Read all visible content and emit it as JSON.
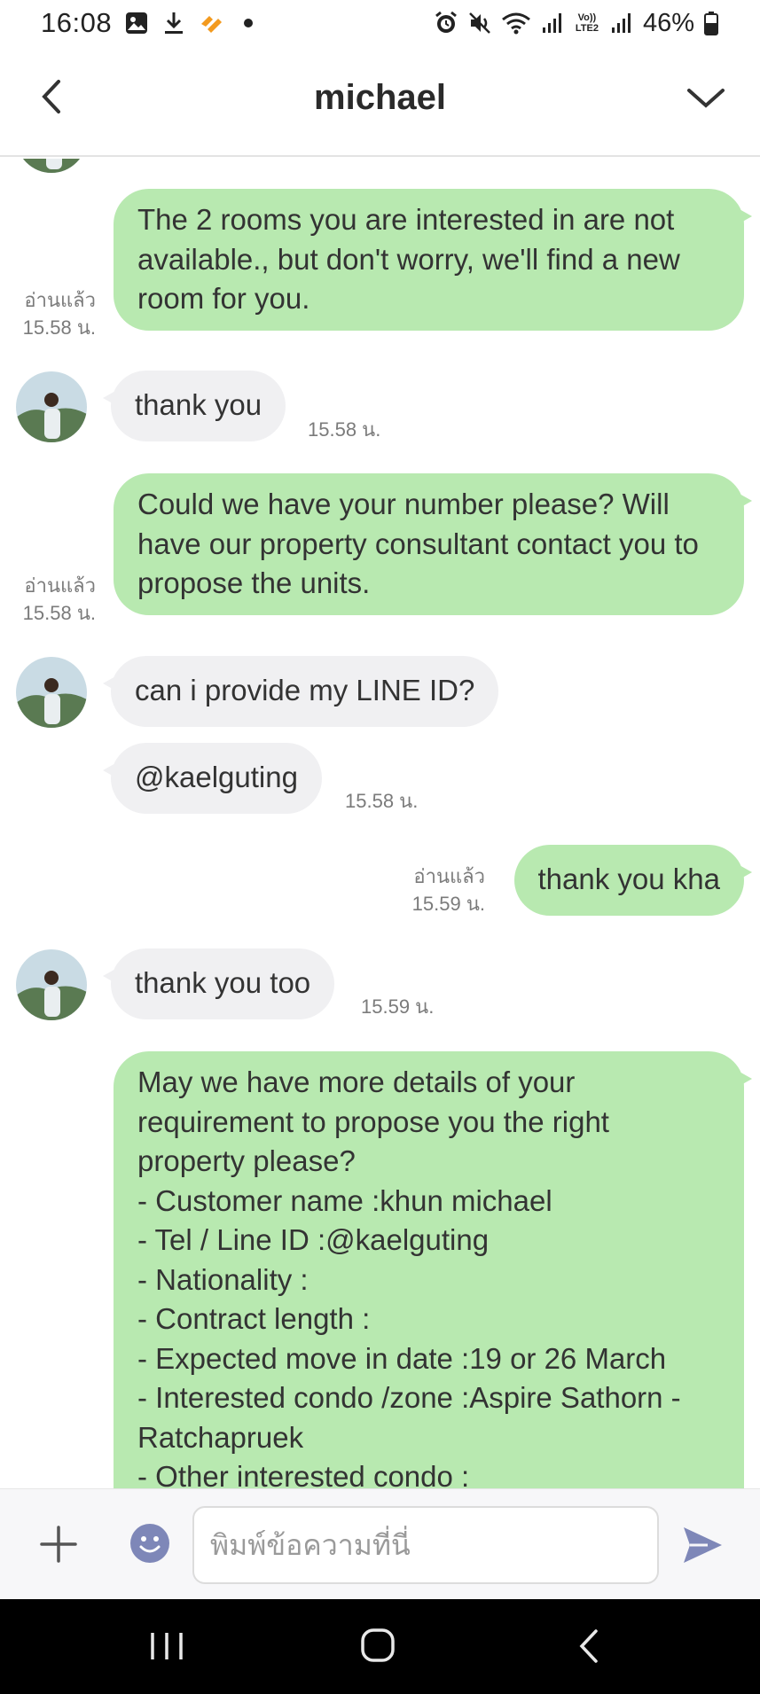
{
  "status_bar": {
    "time": "16:08",
    "battery_percent": "46%",
    "icons_left": [
      "image-icon",
      "download-icon",
      "app-notification-icon",
      "dot-icon"
    ],
    "icons_right": [
      "alarm-icon",
      "mute-icon",
      "wifi-icon",
      "signal-icon",
      "volte-icon",
      "signal-icon",
      "battery-icon"
    ],
    "volte_label": "Vo)) LTE2"
  },
  "header": {
    "title": "michael"
  },
  "messages": [
    {
      "dir": "out",
      "text": "The 2 rooms you are interested in are not available., but don't worry, we'll find a new room for you.",
      "read": "อ่านแล้ว",
      "time": "15.58 น."
    },
    {
      "dir": "in",
      "text": "thank you",
      "time": "15.58 น."
    },
    {
      "dir": "out",
      "text": "Could we have your number please? Will have our property consultant contact you to propose the units.",
      "read": "อ่านแล้ว",
      "time": "15.58 น."
    },
    {
      "dir": "in",
      "text": "can i provide my LINE ID?"
    },
    {
      "dir": "in",
      "text": "@kaelguting",
      "time": "15.58 น."
    },
    {
      "dir": "out",
      "text": "thank you kha",
      "read": "อ่านแล้ว",
      "time": "15.59 น."
    },
    {
      "dir": "in",
      "text": "thank you too",
      "time": "15.59 น."
    },
    {
      "dir": "out",
      "lines": [
        "May we have more details of your",
        "requirement to propose you the right",
        "property please?",
        "- Customer name :khun michael",
        "- Tel / Line ID :@kaelguting",
        "- Nationality :",
        "- Contract length :",
        "- Expected move in date :19 or 26 March",
        "- Interested condo /zone :Aspire Sathorn -",
        "Ratchapruek",
        "- Other interested condo :"
      ]
    }
  ],
  "input": {
    "placeholder": "พิมพ์ข้อความที่นี่",
    "value": ""
  },
  "colors": {
    "outgoing_bubble": "#b8e9b0",
    "incoming_bubble": "#f0f0f2",
    "send_icon": "#7e87b8",
    "smile_icon": "#7e87b8"
  }
}
